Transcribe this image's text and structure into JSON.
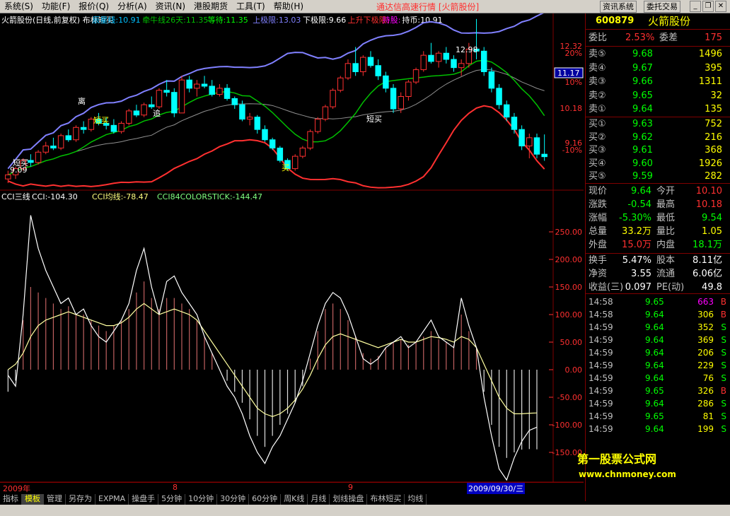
{
  "menu": {
    "items": [
      {
        "label": "系统",
        "key": "S"
      },
      {
        "label": "功能",
        "key": "F"
      },
      {
        "label": "报价",
        "key": "Q"
      },
      {
        "label": "分析",
        "key": "A"
      },
      {
        "label": "资讯",
        "key": "N"
      },
      {
        "label": "港股期货",
        "key": ""
      },
      {
        "label": "工具",
        "key": "T"
      },
      {
        "label": "帮助",
        "key": "H"
      }
    ],
    "app_title": "通达信高速行情 [火箭股份]",
    "btn_system": "资讯系统",
    "btn_trade": "委托交易"
  },
  "main_chart": {
    "header": [
      {
        "text": "火箭股份(日线,前复权) 布林短买",
        "color": "#ffffff"
      },
      {
        "text": "辰星线:10.91",
        "color": "#00c0ff"
      },
      {
        "text": "牵牛线26天:11.35",
        "color": "#00c000"
      },
      {
        "text": "等待:11.35",
        "color": "#00ff00"
      },
      {
        "text": "上极限:13.03",
        "color": "#8080ff"
      },
      {
        "text": "下极限:9.66",
        "color": "#ffffff"
      },
      {
        "text": "上升下极限:",
        "color": "#ff3030"
      },
      {
        "text": "持股:",
        "color": "#ff00ff"
      },
      {
        "text": "持币:10.91",
        "color": "#ffffff"
      }
    ],
    "price_axis": [
      "12.32",
      "20%",
      "11.17",
      "10%",
      "10.18",
      "9.16",
      "-10%"
    ],
    "price_box": "11.17",
    "annotations": [
      "短买",
      "离",
      "追",
      "短买",
      "买",
      "短买",
      "12.98",
      "9.09"
    ]
  },
  "cci_chart": {
    "header": [
      {
        "text": "CCI三线",
        "color": "#ffffff"
      },
      {
        "text": "CCI:-104.30",
        "color": "#ffffff"
      },
      {
        "text": "CCI均线:-78.47",
        "color": "#ffff80"
      },
      {
        "text": "CCI84COLORSTICK:-144.47",
        "color": "#80ff80"
      }
    ],
    "axis": [
      "250.00",
      "200.00",
      "150.00",
      "100.00",
      "50.00",
      "0.00",
      "-50.00",
      "-100.00",
      "-150.00"
    ]
  },
  "chart_data": {
    "type": "candlestick",
    "title": "火箭股份(日线,前复权) 布林短买",
    "ylim": [
      9.0,
      12.6
    ],
    "candles": [
      [
        9.1,
        9.3,
        9.0,
        9.2
      ],
      [
        9.2,
        9.4,
        9.1,
        9.35
      ],
      [
        9.35,
        9.6,
        9.3,
        9.55
      ],
      [
        9.55,
        9.7,
        9.4,
        9.5
      ],
      [
        9.5,
        9.8,
        9.45,
        9.75
      ],
      [
        9.75,
        10.0,
        9.7,
        9.9
      ],
      [
        9.9,
        10.1,
        9.8,
        9.85
      ],
      [
        9.85,
        10.2,
        9.8,
        10.15
      ],
      [
        10.15,
        10.3,
        10.0,
        10.05
      ],
      [
        10.05,
        10.4,
        10.0,
        10.35
      ],
      [
        10.35,
        10.5,
        10.2,
        10.3
      ],
      [
        10.3,
        10.6,
        10.25,
        10.55
      ],
      [
        10.55,
        10.7,
        10.4,
        10.45
      ],
      [
        10.45,
        10.6,
        10.3,
        10.4
      ],
      [
        10.4,
        10.55,
        10.2,
        10.25
      ],
      [
        10.25,
        10.5,
        10.2,
        10.45
      ],
      [
        10.45,
        10.8,
        10.4,
        10.75
      ],
      [
        10.75,
        10.9,
        10.6,
        10.65
      ],
      [
        10.65,
        10.95,
        10.6,
        10.9
      ],
      [
        10.9,
        11.1,
        10.8,
        10.85
      ],
      [
        10.85,
        11.3,
        10.8,
        11.25
      ],
      [
        11.25,
        11.5,
        11.1,
        11.2
      ],
      [
        11.2,
        11.3,
        10.6,
        10.7
      ],
      [
        10.7,
        11.6,
        10.7,
        11.5
      ],
      [
        11.5,
        11.6,
        11.2,
        11.3
      ],
      [
        11.3,
        11.5,
        11.1,
        11.4
      ],
      [
        11.4,
        11.6,
        11.3,
        11.35
      ],
      [
        11.35,
        11.5,
        11.1,
        11.15
      ],
      [
        11.15,
        11.4,
        11.1,
        11.3
      ],
      [
        11.3,
        11.4,
        11.0,
        11.05
      ],
      [
        11.05,
        11.1,
        10.8,
        10.9
      ],
      [
        10.9,
        11.0,
        10.5,
        10.55
      ],
      [
        10.55,
        10.7,
        10.4,
        10.6
      ],
      [
        10.6,
        10.65,
        10.2,
        10.3
      ],
      [
        10.3,
        10.4,
        10.0,
        10.05
      ],
      [
        10.05,
        10.1,
        9.8,
        9.85
      ],
      [
        9.85,
        9.9,
        9.5,
        9.55
      ],
      [
        9.55,
        9.6,
        9.3,
        9.35
      ],
      [
        9.35,
        9.7,
        9.3,
        9.65
      ],
      [
        9.65,
        9.9,
        9.6,
        9.85
      ],
      [
        9.85,
        10.3,
        9.8,
        10.25
      ],
      [
        10.25,
        10.6,
        10.2,
        10.55
      ],
      [
        10.55,
        10.9,
        10.5,
        10.85
      ],
      [
        10.85,
        11.3,
        10.8,
        11.25
      ],
      [
        11.25,
        11.6,
        11.2,
        11.55
      ],
      [
        11.55,
        12.0,
        11.5,
        11.9
      ],
      [
        11.9,
        12.3,
        11.6,
        11.7
      ],
      [
        11.7,
        12.1,
        11.6,
        12.05
      ],
      [
        12.05,
        12.2,
        11.8,
        11.85
      ],
      [
        11.85,
        12.0,
        11.5,
        11.6
      ],
      [
        11.6,
        11.7,
        11.2,
        11.3
      ],
      [
        11.3,
        11.4,
        10.7,
        10.8
      ],
      [
        10.8,
        11.2,
        10.7,
        11.1
      ],
      [
        11.1,
        11.5,
        11.0,
        11.45
      ],
      [
        11.45,
        11.8,
        11.4,
        11.75
      ],
      [
        11.75,
        12.2,
        11.7,
        12.1
      ],
      [
        12.1,
        12.4,
        11.9,
        11.95
      ],
      [
        11.95,
        12.2,
        11.8,
        12.15
      ],
      [
        12.15,
        12.3,
        11.9,
        12.0
      ],
      [
        12.0,
        12.1,
        11.7,
        11.8
      ],
      [
        11.8,
        12.0,
        11.6,
        11.9
      ],
      [
        11.9,
        12.4,
        11.8,
        12.25
      ],
      [
        12.25,
        12.98,
        12.0,
        12.2
      ],
      [
        12.2,
        12.3,
        11.6,
        11.7
      ],
      [
        11.7,
        11.8,
        11.2,
        11.3
      ],
      [
        11.3,
        11.4,
        10.8,
        10.9
      ],
      [
        10.9,
        11.0,
        10.5,
        10.6
      ],
      [
        10.6,
        10.7,
        10.2,
        10.3
      ],
      [
        10.3,
        10.4,
        9.8,
        9.9
      ],
      [
        9.9,
        10.2,
        9.6,
        10.1
      ],
      [
        10.1,
        10.2,
        9.6,
        9.7
      ],
      [
        9.7,
        10.18,
        9.54,
        9.64
      ]
    ],
    "cci": {
      "values": [
        -10,
        -30,
        100,
        280,
        220,
        180,
        150,
        120,
        130,
        100,
        110,
        80,
        60,
        50,
        70,
        90,
        120,
        180,
        220,
        150,
        100,
        160,
        170,
        140,
        120,
        100,
        60,
        30,
        0,
        -30,
        -50,
        -80,
        -120,
        -150,
        -170,
        -140,
        -120,
        -90,
        -60,
        -20,
        30,
        80,
        120,
        140,
        130,
        100,
        60,
        20,
        10,
        20,
        40,
        50,
        60,
        40,
        50,
        70,
        90,
        60,
        50,
        40,
        130,
        80,
        40,
        -50,
        -120,
        -180,
        -200,
        -160,
        -130,
        -110,
        -104.3
      ],
      "ma": [
        0,
        10,
        30,
        60,
        80,
        90,
        95,
        100,
        105,
        100,
        95,
        90,
        85,
        80,
        80,
        85,
        95,
        110,
        120,
        110,
        100,
        105,
        110,
        105,
        100,
        90,
        70,
        50,
        30,
        10,
        -10,
        -30,
        -50,
        -70,
        -80,
        -85,
        -80,
        -70,
        -55,
        -35,
        -10,
        20,
        45,
        60,
        65,
        60,
        55,
        50,
        45,
        40,
        45,
        50,
        55,
        50,
        50,
        55,
        60,
        58,
        55,
        50,
        60,
        55,
        40,
        10,
        -20,
        -50,
        -70,
        -80,
        -80,
        -79,
        -78.47
      ],
      "stick": [
        -40,
        -20,
        90,
        150,
        140,
        130,
        120,
        110,
        115,
        100,
        100,
        90,
        80,
        70,
        80,
        90,
        110,
        140,
        160,
        130,
        110,
        130,
        130,
        120,
        110,
        90,
        60,
        30,
        0,
        -20,
        -40,
        -60,
        -90,
        -120,
        -140,
        -120,
        -100,
        -80,
        -60,
        -30,
        20,
        70,
        110,
        120,
        110,
        90,
        60,
        30,
        20,
        25,
        40,
        50,
        55,
        45,
        50,
        60,
        70,
        55,
        50,
        45,
        100,
        70,
        40,
        -40,
        -100,
        -140,
        -160,
        -150,
        -145,
        -144,
        -144.47
      ],
      "ylim": [
        -200,
        300
      ]
    }
  },
  "right_panel": {
    "code": "600879",
    "name": "火箭股份",
    "weibi_label": "委比",
    "weibi_value": "2.53%",
    "weicha_label": "委差",
    "weicha_value": "175",
    "sell": [
      {
        "label": "卖⑤",
        "price": "9.68",
        "vol": "1496"
      },
      {
        "label": "卖④",
        "price": "9.67",
        "vol": "395"
      },
      {
        "label": "卖③",
        "price": "9.66",
        "vol": "1311"
      },
      {
        "label": "卖②",
        "price": "9.65",
        "vol": "32"
      },
      {
        "label": "卖①",
        "price": "9.64",
        "vol": "135"
      }
    ],
    "buy": [
      {
        "label": "买①",
        "price": "9.63",
        "vol": "752"
      },
      {
        "label": "买②",
        "price": "9.62",
        "vol": "216"
      },
      {
        "label": "买③",
        "price": "9.61",
        "vol": "368"
      },
      {
        "label": "买④",
        "price": "9.60",
        "vol": "1926"
      },
      {
        "label": "买⑤",
        "price": "9.59",
        "vol": "282"
      }
    ],
    "stats": [
      {
        "l1": "现价",
        "v1": "9.64",
        "c1": "#00ff00",
        "l2": "今开",
        "v2": "10.10",
        "c2": "#ff3030"
      },
      {
        "l1": "涨跌",
        "v1": "-0.54",
        "c1": "#00ff00",
        "l2": "最高",
        "v2": "10.18",
        "c2": "#ff3030"
      },
      {
        "l1": "涨幅",
        "v1": "-5.30%",
        "c1": "#00ff00",
        "l2": "最低",
        "v2": "9.54",
        "c2": "#00ff00"
      },
      {
        "l1": "总量",
        "v1": "33.2万",
        "c1": "#ffff00",
        "l2": "量比",
        "v2": "1.05",
        "c2": "#ffff00"
      },
      {
        "l1": "外盘",
        "v1": "15.0万",
        "c1": "#ff3030",
        "l2": "内盘",
        "v2": "18.1万",
        "c2": "#00ff00"
      }
    ],
    "stats2": [
      {
        "l1": "换手",
        "v1": "5.47%",
        "l2": "股本",
        "v2": "8.11亿"
      },
      {
        "l1": "净资",
        "v1": "3.55",
        "l2": "流通",
        "v2": "6.06亿"
      },
      {
        "l1": "收益(三)",
        "v1": "0.097",
        "l2": "PE(动)",
        "v2": "49.8"
      }
    ],
    "ticks": [
      {
        "time": "14:58",
        "price": "9.65",
        "vol": "663",
        "side": "B",
        "vc": "#ff00ff"
      },
      {
        "time": "14:58",
        "price": "9.64",
        "vol": "306",
        "side": "B",
        "vc": "#ffff00"
      },
      {
        "time": "14:59",
        "price": "9.64",
        "vol": "352",
        "side": "S",
        "vc": "#ffff00"
      },
      {
        "time": "14:59",
        "price": "9.64",
        "vol": "369",
        "side": "S",
        "vc": "#ffff00"
      },
      {
        "time": "14:59",
        "price": "9.64",
        "vol": "206",
        "side": "S",
        "vc": "#ffff00"
      },
      {
        "time": "14:59",
        "price": "9.64",
        "vol": "229",
        "side": "S",
        "vc": "#ffff00"
      },
      {
        "time": "14:59",
        "price": "9.64",
        "vol": "76",
        "side": "S",
        "vc": "#ffff00"
      },
      {
        "time": "14:59",
        "price": "9.65",
        "vol": "326",
        "side": "B",
        "vc": "#ffff00"
      },
      {
        "time": "14:59",
        "price": "9.64",
        "vol": "286",
        "side": "S",
        "vc": "#ffff00"
      },
      {
        "time": "14:59",
        "price": "9.65",
        "vol": "81",
        "side": "S",
        "vc": "#ffff00"
      },
      {
        "time": "14:59",
        "price": "9.64",
        "vol": "199",
        "side": "S",
        "vc": "#ffff00"
      }
    ]
  },
  "date_axis": {
    "start": "2009年",
    "m8": "8",
    "m9": "9",
    "current": "2009/09/30/三"
  },
  "toolbar": [
    "指标",
    "模板",
    "管理",
    "另存为",
    "EXPMA",
    "操盘手",
    "5分钟",
    "10分钟",
    "30分钟",
    "60分钟",
    "周K线",
    "月线",
    "划线操盘",
    "布林短买",
    "均线"
  ],
  "watermark": {
    "line1": "第一股票公式网",
    "line2": "www.chnmoney.com"
  }
}
